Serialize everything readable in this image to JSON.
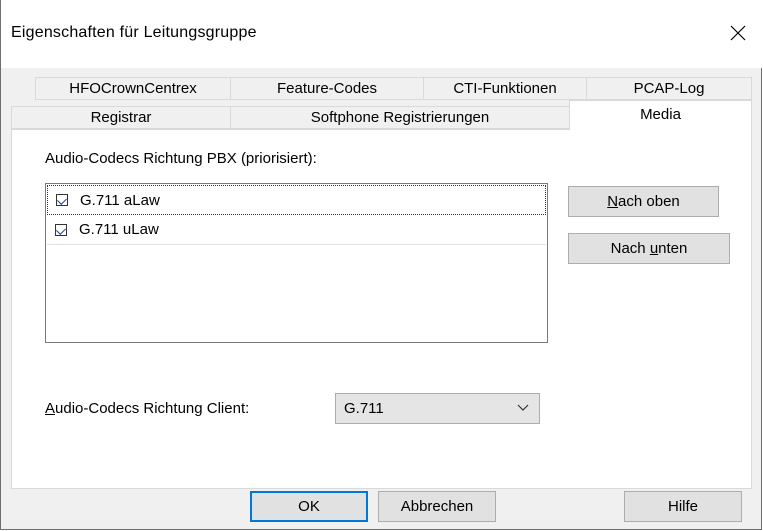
{
  "window": {
    "title": "Eigenschaften für Leitungsgruppe"
  },
  "tabs_row1": [
    "HFOCrownCentrex",
    "Feature-Codes",
    "CTI-Funktionen",
    "PCAP-Log"
  ],
  "tabs_row2": [
    "Registrar",
    "Softphone Registrierungen",
    "Media"
  ],
  "active_tab": "Media",
  "media": {
    "pbx_label": "Audio-Codecs Richtung PBX (priorisiert):",
    "codecs": [
      {
        "label": "G.711 aLaw",
        "checked": true,
        "selected": true
      },
      {
        "label": "G.711 uLaw",
        "checked": true,
        "selected": false
      }
    ],
    "move_up_pre": "",
    "move_up_key": "N",
    "move_up_post": "ach oben",
    "move_down_pre": "Nach ",
    "move_down_key": "u",
    "move_down_post": "nten",
    "client_label_key": "A",
    "client_label_rest": "udio-Codecs Richtung Client:",
    "client_value": "G.711"
  },
  "footer": {
    "ok": "OK",
    "cancel": "Abbrechen",
    "help": "Hilfe"
  },
  "icons": {
    "close": "close-icon",
    "dropdown": "chevron-down-icon",
    "check": "checkmark-icon"
  }
}
